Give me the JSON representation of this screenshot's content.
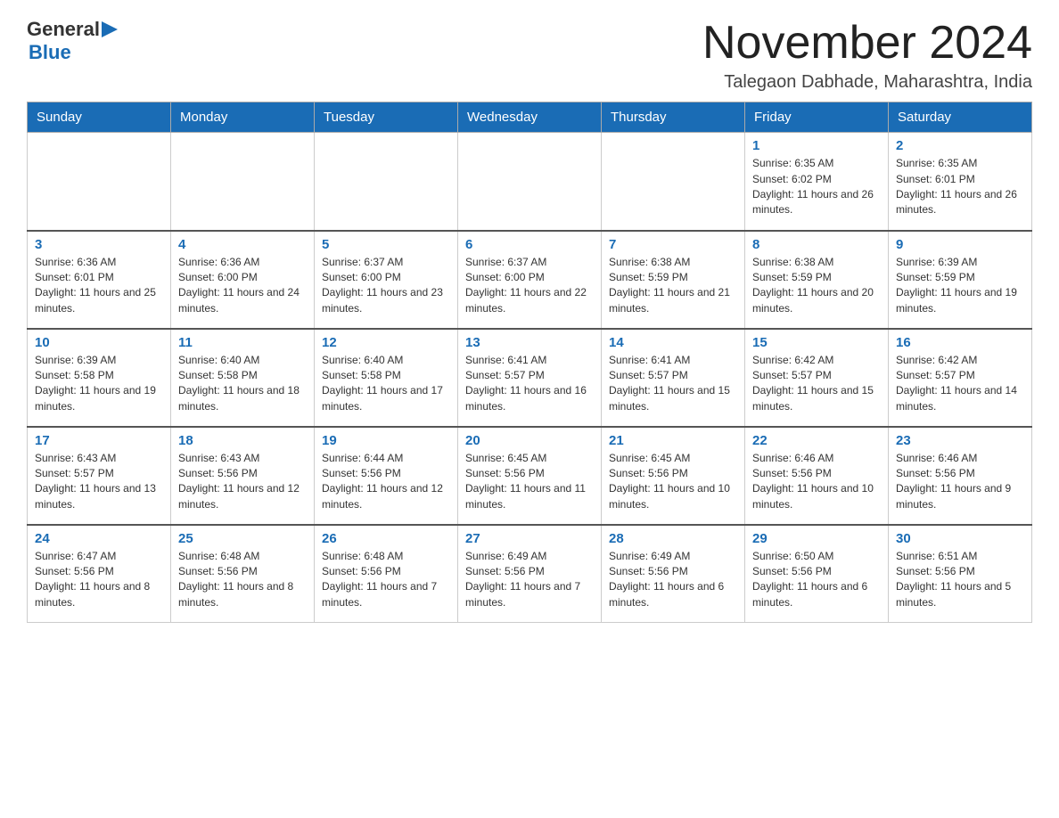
{
  "header": {
    "logo_general": "General",
    "logo_blue": "Blue",
    "month_title": "November 2024",
    "location": "Talegaon Dabhade, Maharashtra, India"
  },
  "days_of_week": [
    "Sunday",
    "Monday",
    "Tuesday",
    "Wednesday",
    "Thursday",
    "Friday",
    "Saturday"
  ],
  "weeks": [
    [
      {
        "day": "",
        "info": ""
      },
      {
        "day": "",
        "info": ""
      },
      {
        "day": "",
        "info": ""
      },
      {
        "day": "",
        "info": ""
      },
      {
        "day": "",
        "info": ""
      },
      {
        "day": "1",
        "info": "Sunrise: 6:35 AM\nSunset: 6:02 PM\nDaylight: 11 hours and 26 minutes."
      },
      {
        "day": "2",
        "info": "Sunrise: 6:35 AM\nSunset: 6:01 PM\nDaylight: 11 hours and 26 minutes."
      }
    ],
    [
      {
        "day": "3",
        "info": "Sunrise: 6:36 AM\nSunset: 6:01 PM\nDaylight: 11 hours and 25 minutes."
      },
      {
        "day": "4",
        "info": "Sunrise: 6:36 AM\nSunset: 6:00 PM\nDaylight: 11 hours and 24 minutes."
      },
      {
        "day": "5",
        "info": "Sunrise: 6:37 AM\nSunset: 6:00 PM\nDaylight: 11 hours and 23 minutes."
      },
      {
        "day": "6",
        "info": "Sunrise: 6:37 AM\nSunset: 6:00 PM\nDaylight: 11 hours and 22 minutes."
      },
      {
        "day": "7",
        "info": "Sunrise: 6:38 AM\nSunset: 5:59 PM\nDaylight: 11 hours and 21 minutes."
      },
      {
        "day": "8",
        "info": "Sunrise: 6:38 AM\nSunset: 5:59 PM\nDaylight: 11 hours and 20 minutes."
      },
      {
        "day": "9",
        "info": "Sunrise: 6:39 AM\nSunset: 5:59 PM\nDaylight: 11 hours and 19 minutes."
      }
    ],
    [
      {
        "day": "10",
        "info": "Sunrise: 6:39 AM\nSunset: 5:58 PM\nDaylight: 11 hours and 19 minutes."
      },
      {
        "day": "11",
        "info": "Sunrise: 6:40 AM\nSunset: 5:58 PM\nDaylight: 11 hours and 18 minutes."
      },
      {
        "day": "12",
        "info": "Sunrise: 6:40 AM\nSunset: 5:58 PM\nDaylight: 11 hours and 17 minutes."
      },
      {
        "day": "13",
        "info": "Sunrise: 6:41 AM\nSunset: 5:57 PM\nDaylight: 11 hours and 16 minutes."
      },
      {
        "day": "14",
        "info": "Sunrise: 6:41 AM\nSunset: 5:57 PM\nDaylight: 11 hours and 15 minutes."
      },
      {
        "day": "15",
        "info": "Sunrise: 6:42 AM\nSunset: 5:57 PM\nDaylight: 11 hours and 15 minutes."
      },
      {
        "day": "16",
        "info": "Sunrise: 6:42 AM\nSunset: 5:57 PM\nDaylight: 11 hours and 14 minutes."
      }
    ],
    [
      {
        "day": "17",
        "info": "Sunrise: 6:43 AM\nSunset: 5:57 PM\nDaylight: 11 hours and 13 minutes."
      },
      {
        "day": "18",
        "info": "Sunrise: 6:43 AM\nSunset: 5:56 PM\nDaylight: 11 hours and 12 minutes."
      },
      {
        "day": "19",
        "info": "Sunrise: 6:44 AM\nSunset: 5:56 PM\nDaylight: 11 hours and 12 minutes."
      },
      {
        "day": "20",
        "info": "Sunrise: 6:45 AM\nSunset: 5:56 PM\nDaylight: 11 hours and 11 minutes."
      },
      {
        "day": "21",
        "info": "Sunrise: 6:45 AM\nSunset: 5:56 PM\nDaylight: 11 hours and 10 minutes."
      },
      {
        "day": "22",
        "info": "Sunrise: 6:46 AM\nSunset: 5:56 PM\nDaylight: 11 hours and 10 minutes."
      },
      {
        "day": "23",
        "info": "Sunrise: 6:46 AM\nSunset: 5:56 PM\nDaylight: 11 hours and 9 minutes."
      }
    ],
    [
      {
        "day": "24",
        "info": "Sunrise: 6:47 AM\nSunset: 5:56 PM\nDaylight: 11 hours and 8 minutes."
      },
      {
        "day": "25",
        "info": "Sunrise: 6:48 AM\nSunset: 5:56 PM\nDaylight: 11 hours and 8 minutes."
      },
      {
        "day": "26",
        "info": "Sunrise: 6:48 AM\nSunset: 5:56 PM\nDaylight: 11 hours and 7 minutes."
      },
      {
        "day": "27",
        "info": "Sunrise: 6:49 AM\nSunset: 5:56 PM\nDaylight: 11 hours and 7 minutes."
      },
      {
        "day": "28",
        "info": "Sunrise: 6:49 AM\nSunset: 5:56 PM\nDaylight: 11 hours and 6 minutes."
      },
      {
        "day": "29",
        "info": "Sunrise: 6:50 AM\nSunset: 5:56 PM\nDaylight: 11 hours and 6 minutes."
      },
      {
        "day": "30",
        "info": "Sunrise: 6:51 AM\nSunset: 5:56 PM\nDaylight: 11 hours and 5 minutes."
      }
    ]
  ]
}
